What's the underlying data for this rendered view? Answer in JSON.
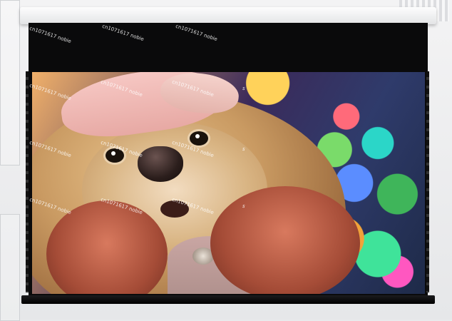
{
  "scene": {
    "watermark_text": "cn1071617 nobie",
    "watermark_short": "s"
  }
}
